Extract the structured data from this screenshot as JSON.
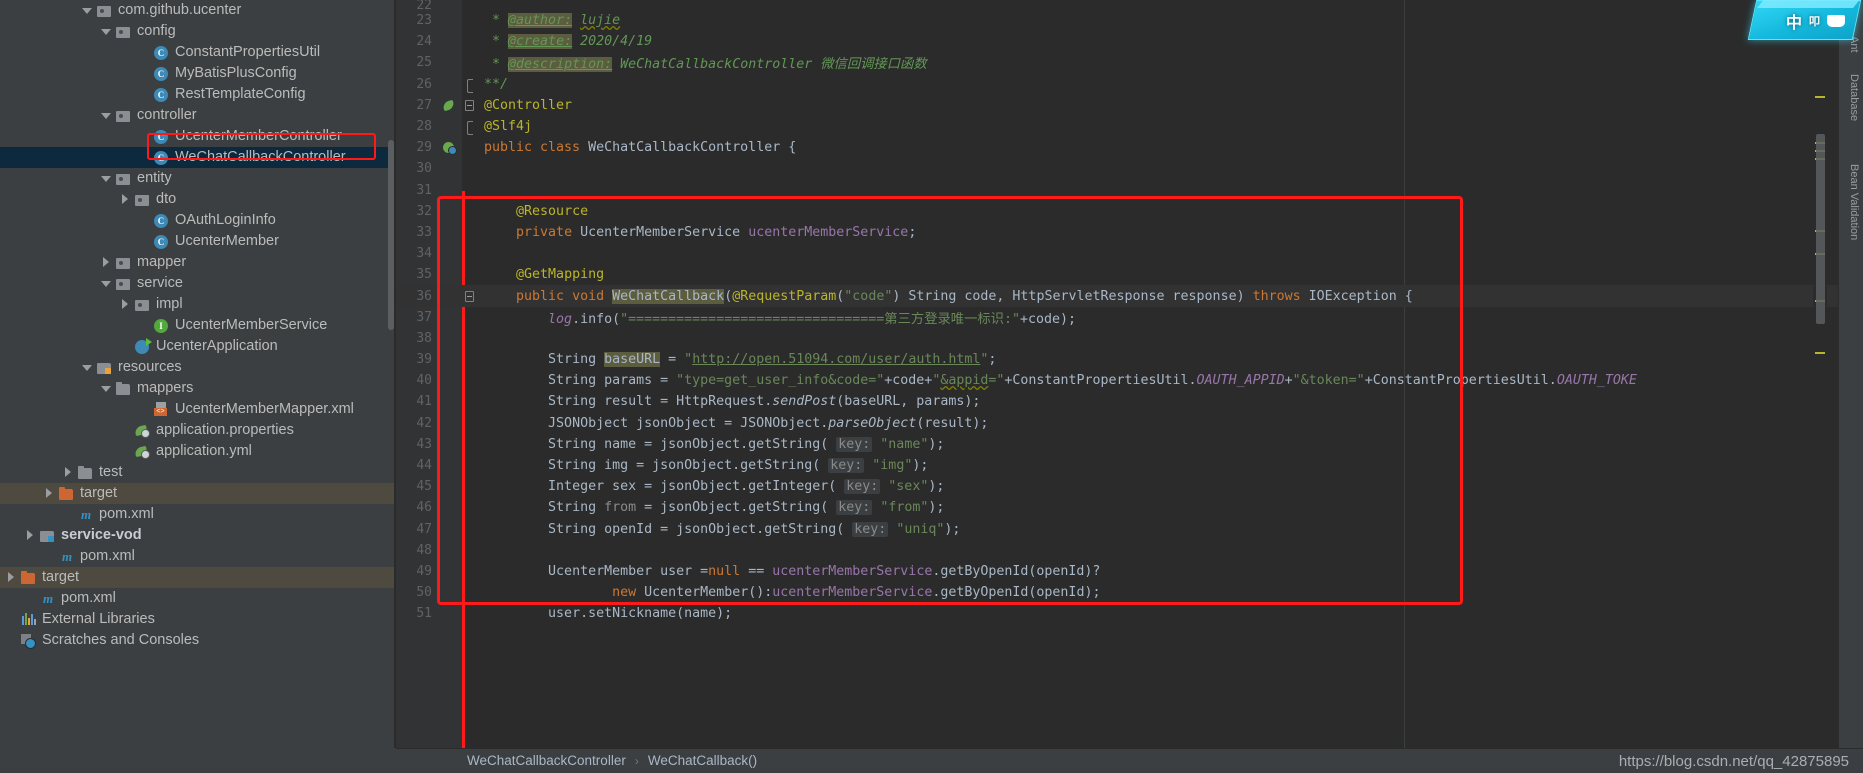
{
  "sidebar": {
    "name": "project-tree",
    "items": [
      {
        "indent": 4,
        "arrow": "down",
        "icon": "package-icon",
        "label": "com.github.ucenter",
        "state": "partial"
      },
      {
        "indent": 5,
        "arrow": "down",
        "icon": "package-icon",
        "label": "config"
      },
      {
        "indent": 7,
        "arrow": "none",
        "icon": "class-icon",
        "label": "ConstantPropertiesUtil"
      },
      {
        "indent": 7,
        "arrow": "none",
        "icon": "class-icon",
        "label": "MyBatisPlusConfig"
      },
      {
        "indent": 7,
        "arrow": "none",
        "icon": "class-icon",
        "label": "RestTemplateConfig"
      },
      {
        "indent": 5,
        "arrow": "down",
        "icon": "package-icon",
        "label": "controller"
      },
      {
        "indent": 7,
        "arrow": "none",
        "icon": "class-icon",
        "label": "UcenterMemberController"
      },
      {
        "indent": 7,
        "arrow": "none",
        "icon": "class-icon",
        "label": "WeChatCallbackController",
        "selected": true,
        "highlighted": true
      },
      {
        "indent": 5,
        "arrow": "down",
        "icon": "package-icon",
        "label": "entity"
      },
      {
        "indent": 6,
        "arrow": "right",
        "icon": "package-icon",
        "label": "dto"
      },
      {
        "indent": 7,
        "arrow": "none",
        "icon": "class-icon",
        "label": "OAuthLoginInfo"
      },
      {
        "indent": 7,
        "arrow": "none",
        "icon": "class-icon",
        "label": "UcenterMember"
      },
      {
        "indent": 5,
        "arrow": "right",
        "icon": "package-icon",
        "label": "mapper"
      },
      {
        "indent": 5,
        "arrow": "down",
        "icon": "package-icon",
        "label": "service"
      },
      {
        "indent": 6,
        "arrow": "right",
        "icon": "package-icon",
        "label": "impl"
      },
      {
        "indent": 7,
        "arrow": "none",
        "icon": "interface-icon",
        "label": "UcenterMemberService"
      },
      {
        "indent": 6,
        "arrow": "none",
        "icon": "spring-app-icon",
        "label": "UcenterApplication"
      },
      {
        "indent": 4,
        "arrow": "down",
        "icon": "resources-folder-icon",
        "label": "resources"
      },
      {
        "indent": 5,
        "arrow": "down",
        "icon": "folder-icon",
        "label": "mappers"
      },
      {
        "indent": 7,
        "arrow": "none",
        "icon": "xml-file-icon",
        "label": "UcenterMemberMapper.xml"
      },
      {
        "indent": 6,
        "arrow": "none",
        "icon": "properties-file-icon",
        "label": "application.properties"
      },
      {
        "indent": 6,
        "arrow": "none",
        "icon": "properties-file-icon",
        "label": "application.yml"
      },
      {
        "indent": 3,
        "arrow": "right",
        "icon": "folder-icon",
        "label": "test"
      },
      {
        "indent": 2,
        "arrow": "right",
        "icon": "target-folder-icon",
        "label": "target",
        "rowHighlight": true
      },
      {
        "indent": 3,
        "arrow": "none",
        "icon": "maven-icon",
        "label": "pom.xml"
      },
      {
        "indent": 1,
        "arrow": "right",
        "icon": "module-folder-icon",
        "label": "service-vod",
        "bold": true
      },
      {
        "indent": 2,
        "arrow": "none",
        "icon": "maven-icon",
        "label": "pom.xml"
      },
      {
        "indent": 0,
        "arrow": "right",
        "icon": "target-folder-icon",
        "label": "target",
        "rowHighlight": true
      },
      {
        "indent": 1,
        "arrow": "none",
        "icon": "maven-icon",
        "label": "pom.xml"
      },
      {
        "indent": 0,
        "arrow": "none",
        "icon": "external-libraries-icon",
        "label": "External Libraries"
      },
      {
        "indent": 0,
        "arrow": "none",
        "icon": "scratches-icon",
        "label": "Scratches and Consoles"
      }
    ]
  },
  "editor": {
    "name": "code-editor",
    "file": "WeChatCallbackController.java",
    "first_line_number": 22,
    "lines": [
      {
        "n": 23,
        "indent": 0
      },
      {
        "n": 24,
        "indent": 0
      },
      {
        "n": 25,
        "indent": 0
      },
      {
        "n": 26,
        "indent": 0
      },
      {
        "n": 27,
        "indent": 0
      },
      {
        "n": 28,
        "indent": 0
      },
      {
        "n": 29,
        "indent": 0
      },
      {
        "n": 30,
        "indent": 0
      }
    ],
    "code_text": {
      "l23": "  * @author: lujie",
      "l24": "  * @create: 2020/4/19",
      "l25": "  * @description: WeChatCallbackController 微信回调接口函数",
      "l26": "  **/",
      "l27": "@Controller",
      "l28": "@Slf4j",
      "l29": "public class WeChatCallbackController {",
      "l30": "",
      "l31": "",
      "l32": "    @Resource",
      "l33": "    private UcenterMemberService ucenterMemberService;",
      "l34": "",
      "l35": "    @GetMapping",
      "l36": "    public void WeChatCallback(@RequestParam(\"code\") String code, HttpServletResponse response) throws IOException {",
      "l37": "        log.info(\"================================第三方登录唯一标识:\"+code);",
      "l38": "",
      "l39": "        String baseURL = \"http://open.51094.com/user/auth.html\";",
      "l40": "        String params = \"type=get_user_info&code=\"+code+\"&appid=\"+ConstantPropertiesUtil.OAUTH_APPID+\"&token=\"+ConstantPropertiesUtil.OAUTH_TOKEN",
      "l41": "        String result = HttpRequest.sendPost(baseURL, params);",
      "l42": "        JSONObject jsonObject = JSONObject.parseObject(result);",
      "l43": "        String name = jsonObject.getString( key: \"name\");",
      "l44": "        String img = jsonObject.getString( key: \"img\");",
      "l45": "        Integer sex = jsonObject.getInteger( key: \"sex\");",
      "l46": "        String from = jsonObject.getString( key: \"from\");",
      "l47": "        String openId = jsonObject.getString( key: \"uniq\");",
      "l48": "",
      "l49": "        UcenterMember user =null == ucenterMemberService.getByOpenId(openId)?",
      "l50": "                new UcenterMember():ucenterMemberService.getByOpenId(openId);",
      "l51": "        user.setNickname(name);"
    },
    "tokens": {
      "author_tag": "@author:",
      "author_value": "lujie",
      "create_tag": "@create:",
      "create_value": "2020/4/19",
      "description_tag": "@description:",
      "description_value": "WeChatCallbackController 微信回调接口函数",
      "comment_close": "**/",
      "ann_controller": "@Controller",
      "ann_slf4j": "@Slf4j",
      "ann_resource": "@Resource",
      "ann_getmapping": "@GetMapping",
      "ann_requestparam": "@RequestParam",
      "kw_public": "public",
      "kw_class": "class",
      "kw_private": "private",
      "kw_void": "void",
      "kw_throws": "throws",
      "kw_new": "new",
      "kw_null": "null",
      "class_name": "WeChatCallbackController",
      "method_name": "WeChatCallback",
      "hint_key": "key:",
      "url_value": "http://open.51094.com/user/auth.html"
    }
  },
  "right_tools": {
    "name": "right-tool-bar",
    "items": [
      "Ant",
      "Database",
      "Bean Validation"
    ]
  },
  "breadcrumb": {
    "name": "navigation-breadcrumb",
    "class": "WeChatCallbackController",
    "separator": "›",
    "method": "WeChatCallback()"
  },
  "status": {
    "watermark": "https://blog.csdn.net/qq_42875895"
  },
  "ime": {
    "name": "ime-indicator",
    "mode": "中",
    "sub": "叩",
    "icon": "keyboard-icon"
  },
  "annotations": {
    "tree_box_color": "#ff1a1a",
    "code_box_color": "#ff1a1a"
  }
}
